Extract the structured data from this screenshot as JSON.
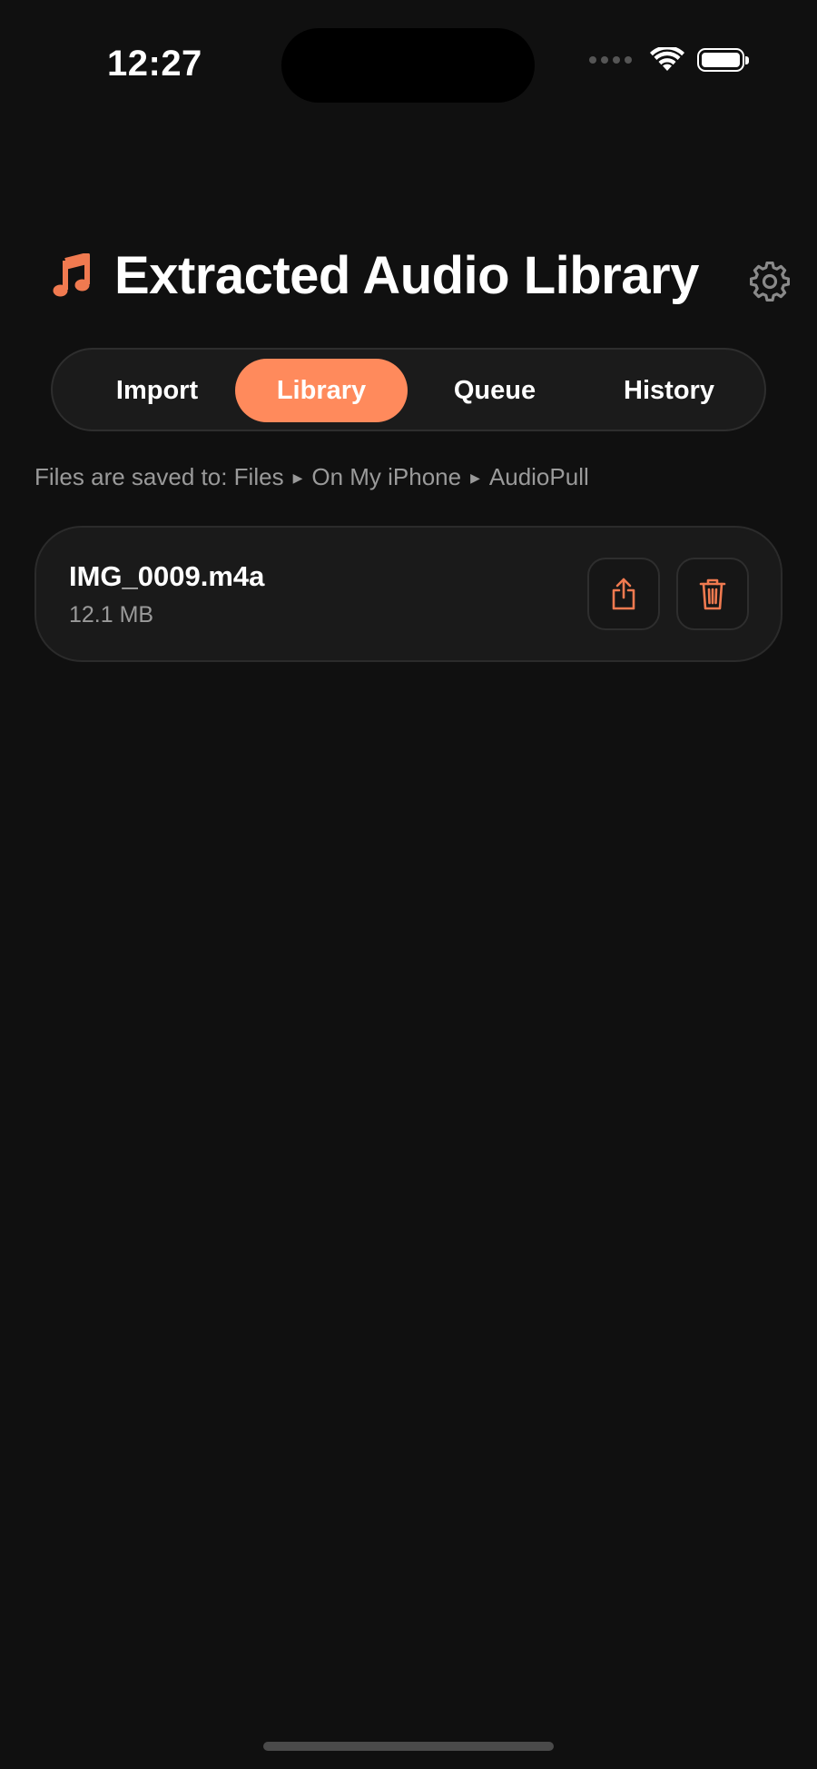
{
  "status_bar": {
    "time": "12:27"
  },
  "header": {
    "title": "Extracted Audio Library",
    "icon": "music-note-icon",
    "settings_icon": "gear-icon"
  },
  "tabs": [
    {
      "label": "Import",
      "active": false
    },
    {
      "label": "Library",
      "active": true
    },
    {
      "label": "Queue",
      "active": false
    },
    {
      "label": "History",
      "active": false
    }
  ],
  "save_path": {
    "prefix": "Files are saved to:",
    "segments": [
      "Files",
      "On My iPhone",
      "AudioPull"
    ]
  },
  "files": [
    {
      "name": "IMG_0009.m4a",
      "size": "12.1 MB",
      "actions": [
        "share-icon",
        "trash-icon"
      ]
    }
  ],
  "colors": {
    "accent": "#ff8a5c",
    "icon_accent": "#f07a50",
    "background": "#101010",
    "card": "#1a1a1a",
    "secondary_text": "#9a9a9a"
  }
}
